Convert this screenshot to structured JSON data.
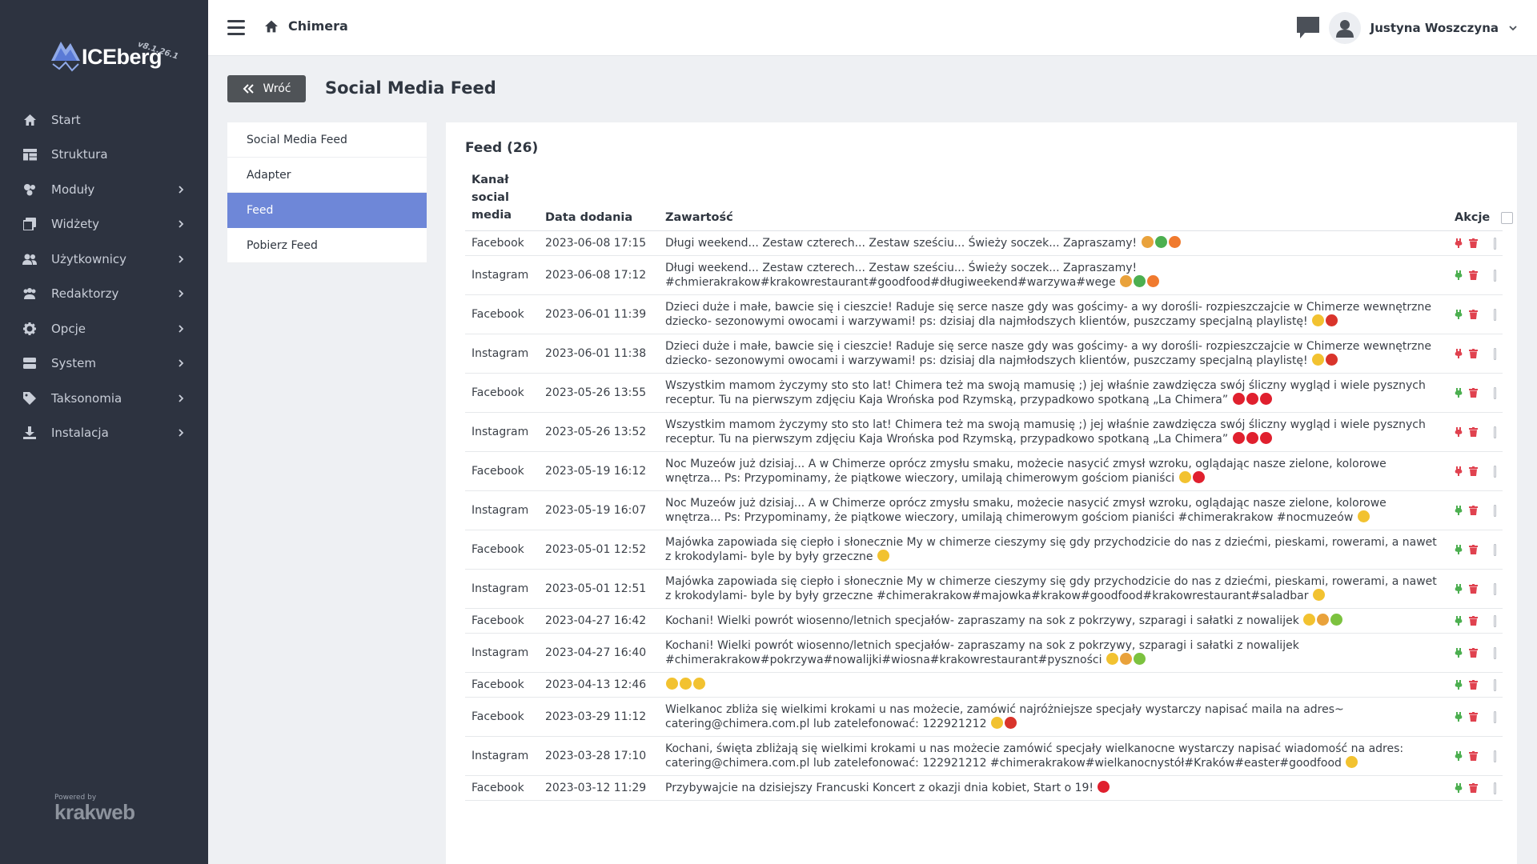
{
  "app": {
    "name": "ICEberg",
    "version": "v8.1.26.1",
    "powered_by": "Powered by",
    "company": "krakweb"
  },
  "sidebar": {
    "items": [
      {
        "label": "Start",
        "icon": "home-icon",
        "has_children": false
      },
      {
        "label": "Struktura",
        "icon": "structure-icon",
        "has_children": false
      },
      {
        "label": "Moduły",
        "icon": "modules-icon",
        "has_children": true
      },
      {
        "label": "Widżety",
        "icon": "widgets-icon",
        "has_children": true
      },
      {
        "label": "Użytkownicy",
        "icon": "users-icon",
        "has_children": true
      },
      {
        "label": "Redaktorzy",
        "icon": "editors-icon",
        "has_children": true
      },
      {
        "label": "Opcje",
        "icon": "gear-icon",
        "has_children": true
      },
      {
        "label": "System",
        "icon": "server-icon",
        "has_children": true
      },
      {
        "label": "Taksonomia",
        "icon": "tags-icon",
        "has_children": true
      },
      {
        "label": "Instalacja",
        "icon": "download-icon",
        "has_children": true
      }
    ]
  },
  "topbar": {
    "site": "Chimera",
    "user": "Justyna Woszczyna"
  },
  "page": {
    "back_label": "Wróć",
    "title": "Social Media Feed"
  },
  "submenu": {
    "items": [
      {
        "label": "Social Media Feed",
        "active": false
      },
      {
        "label": "Adapter",
        "active": false
      },
      {
        "label": "Feed",
        "active": true
      },
      {
        "label": "Pobierz Feed",
        "active": false
      }
    ]
  },
  "feed": {
    "title": "Feed (26)",
    "columns": {
      "channel": "Kanał social media",
      "date": "Data dodania",
      "content": "Zawartość",
      "actions": "Akcje"
    },
    "rows": [
      {
        "channel": "Facebook",
        "date": "2023-06-08 17:15",
        "content": "Długi weekend... Zestaw czterech... Zestaw sześciu... Świeży soczek... Zapraszamy!",
        "emoji": [
          "#e9a23b",
          "#4caf50",
          "#f07a2e"
        ],
        "visible": false
      },
      {
        "channel": "Instagram",
        "date": "2023-06-08 17:12",
        "content": "Długi weekend... Zestaw czterech... Zestaw sześciu... Świeży soczek... Zapraszamy! #chmierakrakow#krakowrestaurant#goodfood#długiweekend#warzywa#wege",
        "emoji": [
          "#e9a23b",
          "#4caf50",
          "#f07a2e"
        ],
        "visible": true
      },
      {
        "channel": "Facebook",
        "date": "2023-06-01 11:39",
        "content": "Dzieci duże i małe, bawcie się i cieszcie! Raduje się serce nasze gdy was gościmy- a wy dorośli- rozpieszczajcie w Chimerze wewnętrzne dziecko- sezonowymi owocami i warzywami! ps: dzisiaj dla najmłodszych klientów, puszczamy specjalną playlistę!",
        "emoji": [
          "#f2c230",
          "#d9342b"
        ],
        "visible": true
      },
      {
        "channel": "Instagram",
        "date": "2023-06-01 11:38",
        "content": "Dzieci duże i małe, bawcie się i cieszcie! Raduje się serce nasze gdy was gościmy- a wy dorośli- rozpieszczajcie w Chimerze wewnętrzne dziecko- sezonowymi owocami i warzywami! ps: dzisiaj dla najmłodszych klientów, puszczamy specjalną playlistę!",
        "emoji": [
          "#f2c230",
          "#d9342b"
        ],
        "visible": false
      },
      {
        "channel": "Facebook",
        "date": "2023-05-26 13:55",
        "content": "Wszystkim mamom życzymy sto sto lat! Chimera też ma swoją mamusię ;) jej właśnie zawdzięcza swój śliczny wygląd i wiele pysznych receptur. Tu na pierwszym zdjęciu Kaja Wrońska pod Rzymską, przypadkowo spotkaną „La Chimera”",
        "emoji": [
          "#e0202e",
          "#e0202e",
          "#e0202e"
        ],
        "visible": true
      },
      {
        "channel": "Instagram",
        "date": "2023-05-26 13:52",
        "content": "Wszystkim mamom życzymy sto sto lat! Chimera też ma swoją mamusię ;) jej właśnie zawdzięcza swój śliczny wygląd i wiele pysznych receptur. Tu na pierwszym zdjęciu Kaja Wrońska pod Rzymską, przypadkowo spotkaną „La Chimera”",
        "emoji": [
          "#e0202e",
          "#e0202e",
          "#e0202e"
        ],
        "visible": false
      },
      {
        "channel": "Facebook",
        "date": "2023-05-19 16:12",
        "content": "Noc Muzeów już dzisiaj... A w Chimerze oprócz zmysłu smaku, możecie nasycić zmysł wzroku, oglądając nasze zielone, kolorowe wnętrza... Ps: Przypominamy, że piątkowe wieczory, umilają chimerowym gościom pianiści",
        "emoji": [
          "#f2c230",
          "#e0202e"
        ],
        "visible": false
      },
      {
        "channel": "Instagram",
        "date": "2023-05-19 16:07",
        "content": "Noc Muzeów już dzisiaj... A w Chimerze oprócz zmysłu smaku, możecie nasycić zmysł wzroku, oglądając nasze zielone, kolorowe wnętrza... Ps: Przypominamy, że piątkowe wieczory, umilają chimerowym gościom pianiści #chimerakrakow #nocmuzeów",
        "emoji": [
          "#f2c230"
        ],
        "visible": true
      },
      {
        "channel": "Facebook",
        "date": "2023-05-01 12:52",
        "content": "Majówka zapowiada się ciepło i słonecznie My w chimerze cieszymy się gdy przychodzicie do nas z dziećmi, pieskami, rowerami, a nawet z krokodylami- byle by były grzeczne",
        "emoji": [
          "#f2c230"
        ],
        "visible": true
      },
      {
        "channel": "Instagram",
        "date": "2023-05-01 12:51",
        "content": "Majówka zapowiada się ciepło i słonecznie My w chimerze cieszymy się gdy przychodzicie do nas z dziećmi, pieskami, rowerami, a nawet z krokodylami- byle by były grzeczne #chimerakrakow#majowka#krakow#goodfood#krakowrestaurant#saladbar",
        "emoji": [
          "#f2c230"
        ],
        "visible": true
      },
      {
        "channel": "Facebook",
        "date": "2023-04-27 16:42",
        "content": "Kochani! Wielki powrót wiosenno/letnich specjałów- zapraszamy na sok z pokrzywy, szparagi i sałatki z nowalijek",
        "emoji": [
          "#f2c230",
          "#e9a23b",
          "#7cc23f"
        ],
        "visible": true
      },
      {
        "channel": "Instagram",
        "date": "2023-04-27 16:40",
        "content": "Kochani! Wielki powrót wiosenno/letnich specjałów- zapraszamy na sok z pokrzywy, szparagi i sałatki z nowalijek #chimerakrakow#pokrzywa#nowalijki#wiosna#krakowrestaurant#pyszności",
        "emoji": [
          "#f2c230",
          "#e9a23b",
          "#7cc23f"
        ],
        "visible": true
      },
      {
        "channel": "Facebook",
        "date": "2023-04-13 12:46",
        "content": "",
        "emoji": [
          "#f2c230",
          "#f2c230",
          "#f2c230"
        ],
        "visible": true
      },
      {
        "channel": "Facebook",
        "date": "2023-03-29 11:12",
        "content": "Wielkanoc zbliża się wielkimi krokami u nas możecie, zamówić najróżniejsze specjały wystarczy napisać maila na adres~ catering@chimera.com.pl lub zatelefonować: 122921212",
        "emoji": [
          "#f2c230",
          "#d9342b"
        ],
        "visible": true
      },
      {
        "channel": "Instagram",
        "date": "2023-03-28 17:10",
        "content": "Kochani, święta zbliżają się wielkimi krokami u nas możecie zamówić specjały wielkanocne wystarczy napisać wiadomość na adres: catering@chimera.com.pl lub zatelefonować: 122921212 #chimerakrakow#wielkanocnystół#Kraków#easter#goodfood",
        "emoji": [
          "#f2c230"
        ],
        "visible": true
      },
      {
        "channel": "Facebook",
        "date": "2023-03-12 11:29",
        "content": "Przybywajcie na dzisiejszy Francuski Koncert z okazji dnia kobiet, Start o 19!",
        "emoji": [
          "#e0202e"
        ],
        "visible": true
      }
    ]
  },
  "colors": {
    "sidebar_bg": "#2d3340",
    "active_item": "#6e87d8",
    "visible_icon": "#4caf50",
    "hidden_icon": "#e0424f",
    "delete_icon": "#e0424f",
    "back_button": "#4f5357"
  }
}
